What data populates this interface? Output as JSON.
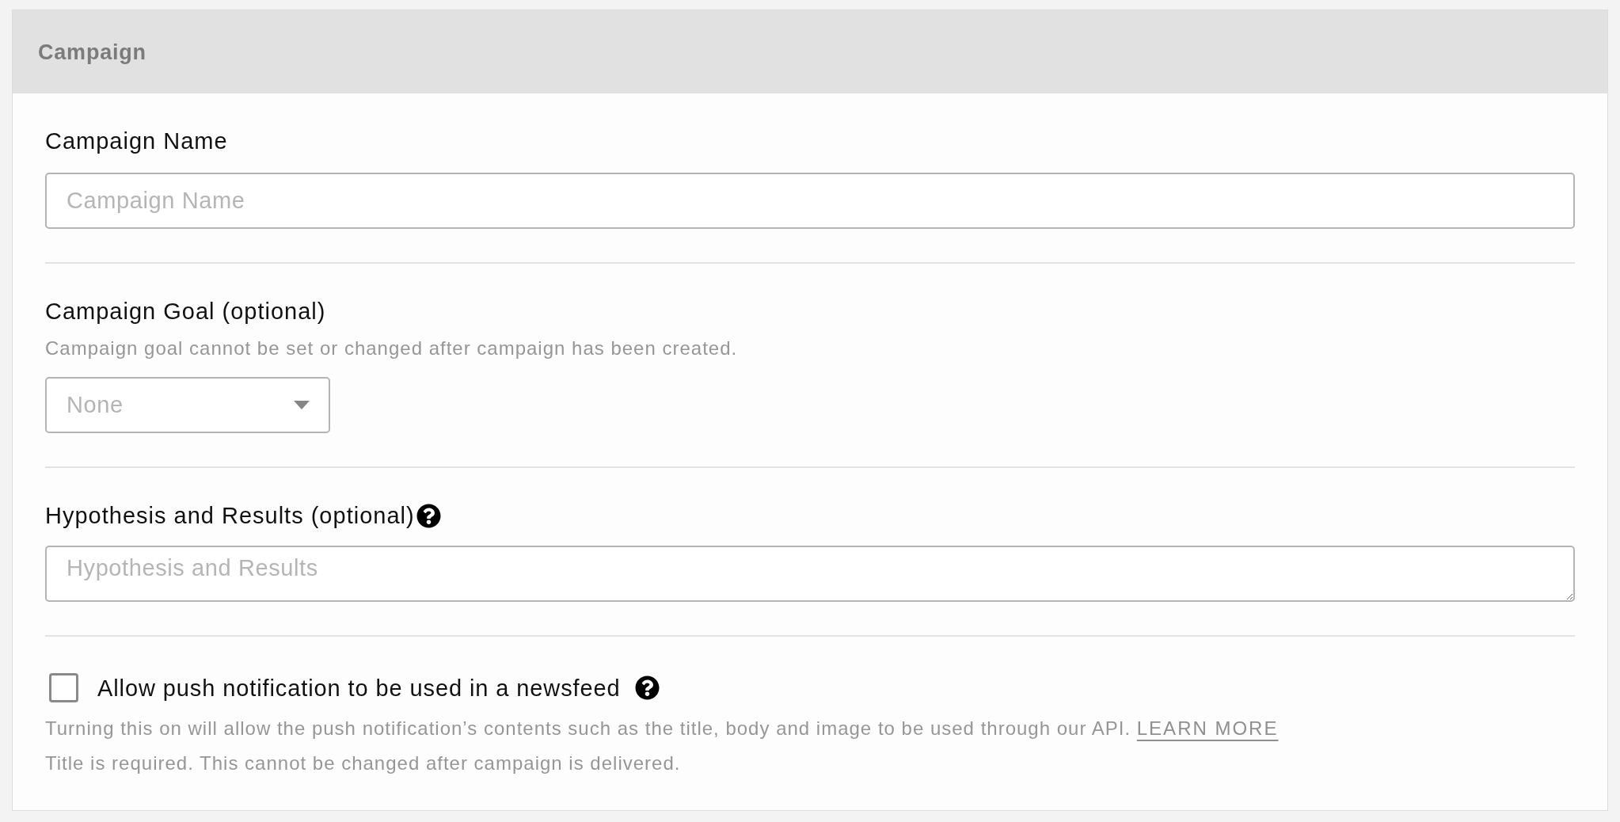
{
  "panel": {
    "title": "Campaign"
  },
  "campaign_name": {
    "label": "Campaign Name",
    "placeholder": "Campaign Name"
  },
  "campaign_goal": {
    "label": "Campaign Goal (optional)",
    "help": "Campaign goal cannot be set or changed after campaign has been created.",
    "select": {
      "placeholder": "None"
    }
  },
  "hypothesis": {
    "label": "Hypothesis and Results (optional)",
    "placeholder": "Hypothesis and Results"
  },
  "newsfeed": {
    "label": "Allow push notification to be used in a newsfeed",
    "checked": false,
    "help": "Turning this on will allow the push notification’s contents such as the title, body and image to be used through our API.",
    "link": "LEARN MORE",
    "note": "Title is required. This cannot be changed after campaign is delivered."
  }
}
